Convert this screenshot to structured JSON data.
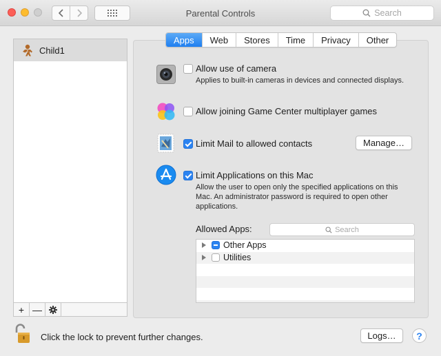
{
  "window": {
    "title": "Parental Controls",
    "search_placeholder": "Search"
  },
  "sidebar": {
    "users": [
      {
        "name": "Child1"
      }
    ],
    "tools": {
      "add": "+",
      "remove": "—",
      "settings": "✱"
    }
  },
  "tabs": [
    {
      "label": "Apps",
      "active": true
    },
    {
      "label": "Web",
      "active": false
    },
    {
      "label": "Stores",
      "active": false
    },
    {
      "label": "Time",
      "active": false
    },
    {
      "label": "Privacy",
      "active": false
    },
    {
      "label": "Other",
      "active": false
    }
  ],
  "options": {
    "camera": {
      "label": "Allow use of camera",
      "description": "Applies to built-in cameras in devices and connected displays.",
      "checked": false
    },
    "game_center": {
      "label": "Allow joining Game Center multiplayer games",
      "checked": false
    },
    "mail": {
      "label": "Limit Mail to allowed contacts",
      "checked": true,
      "button": "Manage…"
    },
    "apps": {
      "label": "Limit Applications on this Mac",
      "description": "Allow the user to open only the specified applications on this Mac. An administrator password is required to open other applications.",
      "checked": true
    }
  },
  "allowed_apps": {
    "label": "Allowed Apps:",
    "search_placeholder": "Search",
    "items": [
      {
        "name": "Other Apps",
        "state": "mixed"
      },
      {
        "name": "Utilities",
        "state": "unchecked"
      }
    ]
  },
  "footer": {
    "lock_text": "Click the lock to prevent further changes.",
    "logs_button": "Logs…",
    "help": "?"
  },
  "colors": {
    "accent": "#2b83f1",
    "close": "#fc5f57",
    "minimize": "#fdbc2e"
  }
}
